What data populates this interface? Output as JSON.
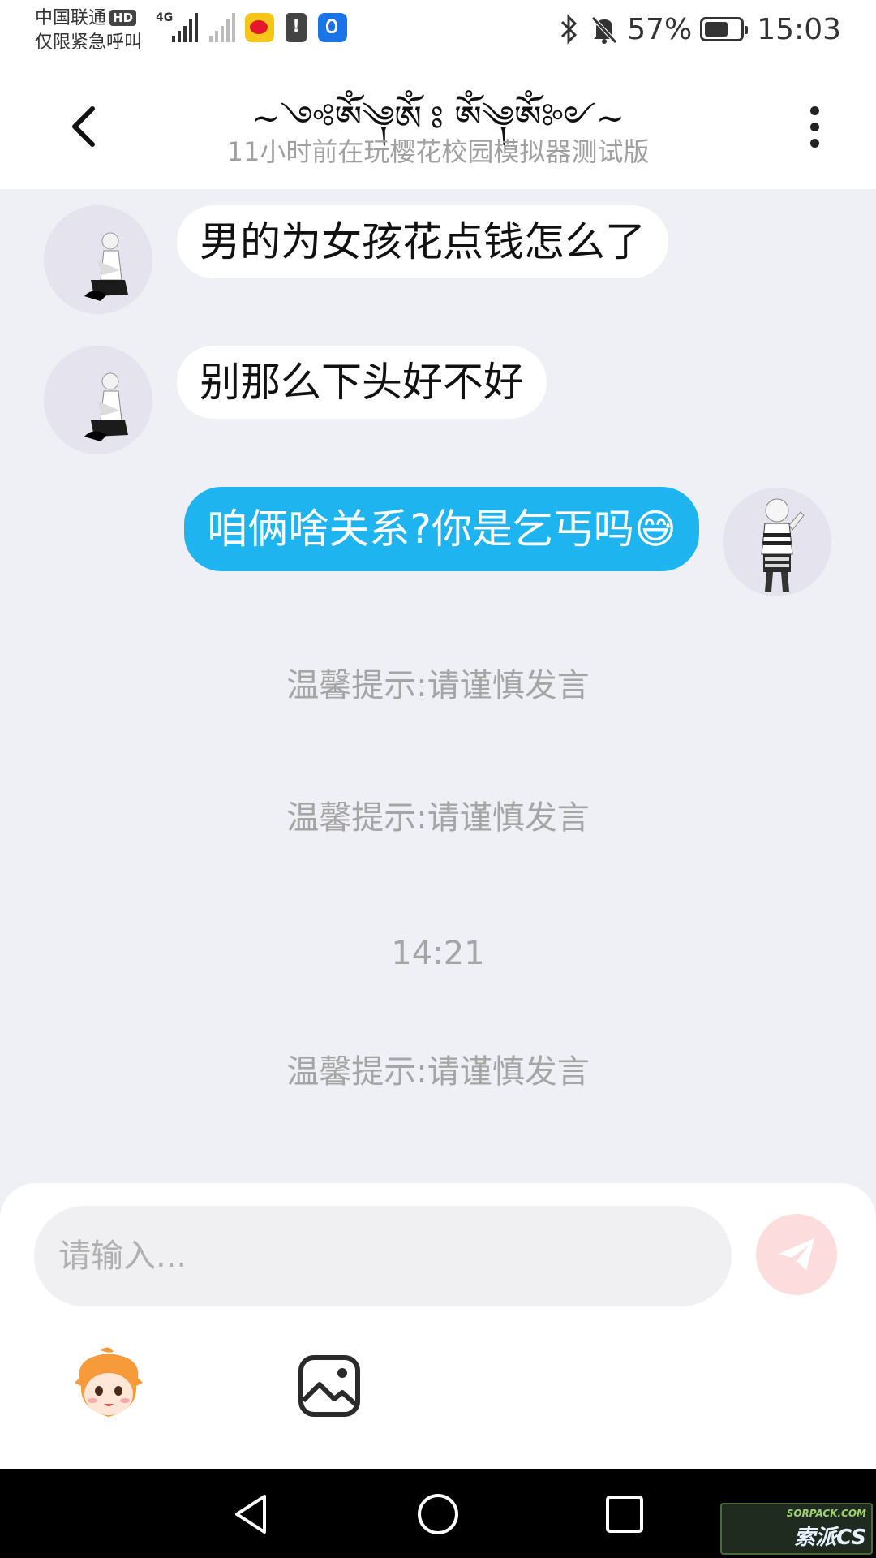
{
  "status_bar": {
    "carrier_line1": "中国联通",
    "hd_badge": "HD",
    "carrier_line2": "仅限紧急呼叫",
    "network": "4G",
    "battery_percent": "57%",
    "time": "15:03",
    "battery_level": 0.57
  },
  "header": {
    "title": "~༺ༀ༆ༀ ཿ ༀ༆ༀ༻~",
    "subtitle": "11小时前在玩樱花校园模拟器测试版"
  },
  "messages": [
    {
      "side": "in",
      "text": "男的为女孩花点钱怎么了"
    },
    {
      "side": "in",
      "text": "别那么下头好不好"
    },
    {
      "side": "out",
      "text": "咱俩啥关系?你是乞丐吗😅"
    }
  ],
  "notices": {
    "notice_1": "温馨提示:请谨慎发言",
    "notice_2": "温馨提示:请谨慎发言",
    "timestamp": "14:21",
    "notice_3": "温馨提示:请谨慎发言"
  },
  "composer": {
    "placeholder": "请输入..."
  },
  "watermark": {
    "line1": "SORPACK.COM",
    "line2": "索派CS"
  },
  "colors": {
    "outgoing_bubble": "#1eb4f0",
    "incoming_bubble": "#ffffff",
    "chat_background": "#eff0f5",
    "send_button": "#fddcdd"
  },
  "icons": {
    "back": "chevron-left-icon",
    "more": "more-vertical-icon",
    "send": "paper-plane-icon",
    "emoji": "emoji-face-icon",
    "image": "image-icon",
    "nav_back": "triangle-back-icon",
    "nav_home": "circle-home-icon",
    "nav_recents": "square-recents-icon"
  }
}
